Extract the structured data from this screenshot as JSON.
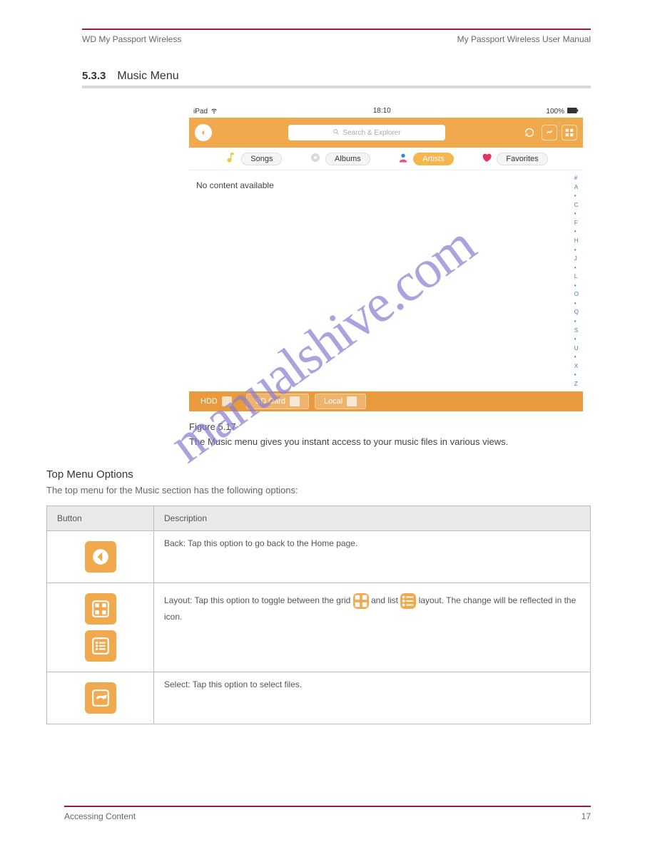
{
  "header": {
    "left": "WD My Passport Wireless",
    "right": "My Passport Wireless User Manual"
  },
  "section": {
    "number": "5.3.3",
    "title": "Music Menu"
  },
  "screenshot": {
    "status": {
      "carrier": "iPad",
      "wifi": "wifi",
      "time": "18:10",
      "battery_pct": "100%"
    },
    "search_placeholder": "Search & Explorer",
    "filters": {
      "songs": "Songs",
      "albums": "Albums",
      "artists": "Artists",
      "favorites": "Favorites"
    },
    "message": "No content available",
    "alpha_index": [
      "#",
      "A",
      "•",
      "C",
      "•",
      "F",
      "•",
      "H",
      "•",
      "J",
      "•",
      "L",
      "•",
      "O",
      "•",
      "Q",
      "•",
      "S",
      "•",
      "U",
      "•",
      "X",
      "•",
      "Z"
    ],
    "storage": {
      "hdd": "HDD",
      "sd": "SD Card",
      "local": "Local"
    }
  },
  "caption": {
    "line1": "Figure 5.17",
    "line2": "The Music menu gives you instant access to your music files in various views."
  },
  "options": {
    "heading": "Top Menu Options",
    "body": "The top menu for the Music section has the following options:",
    "th_button": "Button",
    "th_desc": "Description",
    "rows": [
      {
        "desc": "Back: Tap this option to go back to the Home page."
      },
      {
        "desc_pre": "Layout: Tap this option to toggle between the grid ",
        "desc_mid": " and list ",
        "desc_post": " layout. The change will be reflected in the icon."
      },
      {
        "desc": "Select: Tap this option to select files."
      }
    ]
  },
  "footer": {
    "left": "Accessing Content",
    "right": "17"
  },
  "watermark": "manualshive.com"
}
